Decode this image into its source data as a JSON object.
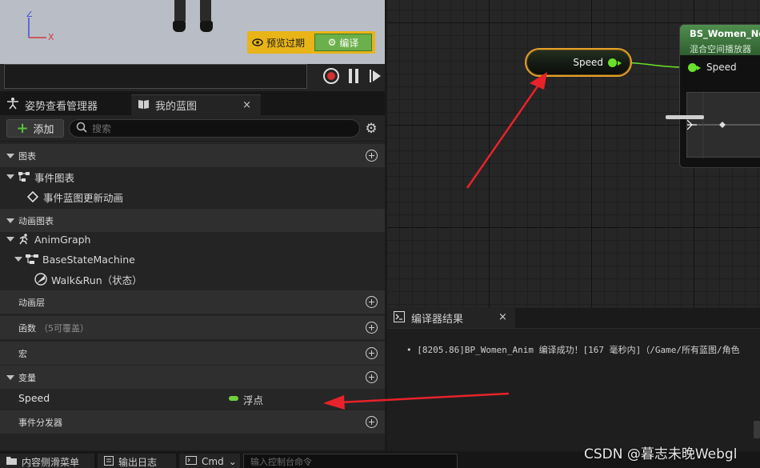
{
  "viewport": {
    "axis_x_label": "X",
    "axis_z_label": "Z",
    "preview_label": "预览过期",
    "compile_label": "编译"
  },
  "tabs": {
    "pose_manager": "姿势查看管理器",
    "my_blueprint": "我的蓝图",
    "close_glyph": "×"
  },
  "toolbar": {
    "add_label": "添加",
    "search_placeholder": "搜索"
  },
  "tree": {
    "sections": {
      "graphs": "图表",
      "anim_graphs": "动画图表",
      "anim_layers": "动画层",
      "functions": "函数",
      "functions_note": "（5可覆盖）",
      "macros": "宏",
      "variables": "变量",
      "dispatchers": "事件分发器"
    },
    "event_graph": "事件图表",
    "event_blueprint_update": "事件蓝图更新动画",
    "anim_graph": "AnimGraph",
    "state_machine": "BaseStateMachine",
    "state": "Walk&Run（状态）"
  },
  "variables": [
    {
      "name": "Speed",
      "type": "浮点",
      "type_color": "#70d03a"
    }
  ],
  "graph": {
    "getter_label": "Speed",
    "node_title": "BS_Women_No",
    "node_subtitle": "混合空间播放器",
    "node_pin_label": "Speed",
    "pin_color": "#69e02a",
    "selection_color": "#e3a02a"
  },
  "compiler": {
    "tab_label": "编译器结果",
    "message": "• [8205.86]BP_Women_Anim 编译成功！[167 毫秒内]（/Game/所有蓝图/角色"
  },
  "bottom": {
    "content_drawer": "内容侧滑菜单",
    "output_log": "输出日志",
    "cmd": "Cmd",
    "console_placeholder": "输入控制台命令"
  },
  "watermark": "CSDN @暮志未晚Webgl",
  "annotation_color": "#e8222a"
}
